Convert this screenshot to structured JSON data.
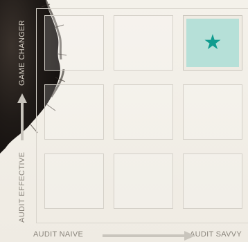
{
  "axes": {
    "y_low": "AUDIT EFFECTIVE",
    "y_high": "GAME CHANGER",
    "x_low": "AUDIT NAIVE",
    "x_high": "AUDIT SAVVY"
  },
  "grid": {
    "rows": 3,
    "cols": 3,
    "highlight_row": 0,
    "highlight_col": 2
  },
  "icons": {
    "highlight": "star-icon"
  },
  "colors": {
    "background": "#f1ede5",
    "grid_border": "#d4d0c8",
    "highlight_fill": "#b6e0d8",
    "star": "#119c8f",
    "label": "#8a857c",
    "arrow": "#c9c5bd"
  }
}
